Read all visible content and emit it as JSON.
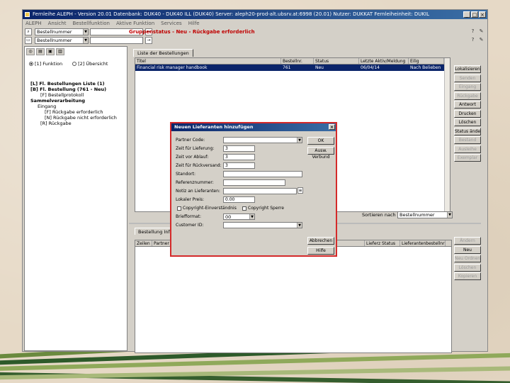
{
  "window": {
    "title": "Fernleihe ALEPH - Version 20.01 Datenbank: DUK40 - DUK40 ILL (DUK40) Server: aleph20-prod-alt.ubsrv.at:6998 (20.01) Nutzer: DUKKAT Fernleiheinheit: DUKIL",
    "controls": [
      "_",
      "□",
      "×"
    ]
  },
  "menubar": [
    "ALEPH",
    "Ansicht",
    "Bestellfunktion",
    "Aktive Funktion",
    "Services",
    "Hilfe"
  ],
  "search": {
    "field1": "Bestellnummer",
    "field2": "Bestellnummer",
    "status_message": "Gruppenstatus - Neu - Rückgabe erforderlich"
  },
  "left_panel": {
    "radio1": "[1] Funktion",
    "radio2": "[2] Übersicht",
    "tree": [
      {
        "text": "[L] Fl. Bestellungen Liste (1)",
        "bold": true,
        "indent": 0
      },
      {
        "text": "[B] Fl. Bestellung (761 - Neu)",
        "bold": true,
        "indent": 0
      },
      {
        "text": "[F] Bestellprotokoll",
        "bold": false,
        "indent": 1
      },
      {
        "text": "Sammelverarbeitung",
        "bold": true,
        "indent": 0
      },
      {
        "text": "Eingang",
        "bold": false,
        "indent": 1
      },
      {
        "text": "[F] Rückgabe erforderlich",
        "bold": false,
        "indent": 2
      },
      {
        "text": "[N] Rückgabe nicht erforderlich",
        "bold": false,
        "indent": 2
      },
      {
        "text": "[R] Rückgabe",
        "bold": false,
        "indent": 1
      }
    ]
  },
  "main": {
    "tab_label": "Liste der Bestellungen",
    "columns": [
      "Titel",
      "Bestellnr.",
      "Status",
      "Letzte Aktiv/Meldung",
      "Eilig"
    ],
    "rows": [
      {
        "cells": [
          "Financial risk manager handbook",
          "761",
          "Neu",
          "06/04/14",
          "Nach Belieben"
        ]
      }
    ],
    "sort_label": "Sortieren nach",
    "sort_value": "Bestellnummer"
  },
  "right_buttons": [
    {
      "label": "Lokalisieren",
      "enabled": true
    },
    {
      "label": "Senden",
      "enabled": false
    },
    {
      "label": "Eingang",
      "enabled": false
    },
    {
      "label": "Rückgabe",
      "enabled": false
    },
    {
      "label": "Antwort",
      "enabled": true
    },
    {
      "label": "Drucken",
      "enabled": true
    },
    {
      "label": "Löschen",
      "enabled": true
    },
    {
      "label": "Status ändern",
      "enabled": true
    },
    {
      "label": "Bestand",
      "enabled": false
    },
    {
      "label": "Ausleihe",
      "enabled": false
    },
    {
      "label": "Exemplar",
      "enabled": false
    }
  ],
  "bottom": {
    "tab_label": "Bestellung Inform.",
    "columns": [
      "Zeilen",
      "Partner Code",
      "Lieferant",
      "Lieferz Status",
      "Lieferantenbestellnr"
    ],
    "buttons": [
      {
        "label": "Ändern",
        "enabled": false
      },
      {
        "label": "Neu",
        "enabled": true
      },
      {
        "label": "Neu Ordnen",
        "enabled": false
      },
      {
        "label": "Löschen",
        "enabled": false
      },
      {
        "label": "Kopieren",
        "enabled": false
      }
    ]
  },
  "dialog": {
    "title": "Neuen Lieferanten hinzufügen",
    "close": "×",
    "fields": [
      {
        "label": "Partner Code:",
        "value": "",
        "type": "combo"
      },
      {
        "label": "Zeit für Lieferung:",
        "value": "3",
        "type": "text"
      },
      {
        "label": "Zeit vor Ablauf:",
        "value": "3",
        "type": "text"
      },
      {
        "label": "Zeit für Rückversand:",
        "value": "3",
        "type": "text"
      },
      {
        "label": "Standort:",
        "value": "",
        "type": "text"
      },
      {
        "label": "Referenznummer:",
        "value": "",
        "type": "text"
      },
      {
        "label": "Notiz an Lieferanten:",
        "value": "",
        "type": "text"
      },
      {
        "label": "Lokaler Preis:",
        "value": "0.00",
        "type": "text"
      }
    ],
    "check1": "Copyright-Einverständnis",
    "check2": "Copyright Sperre",
    "format_label": "Briefformat:",
    "format_value": "00",
    "customer_label": "Customer ID:",
    "buttons": {
      "ok": "OK",
      "duplicate": "Ausw. Verbund",
      "cancel": "Abbrechen",
      "help": "Hilfe"
    }
  }
}
